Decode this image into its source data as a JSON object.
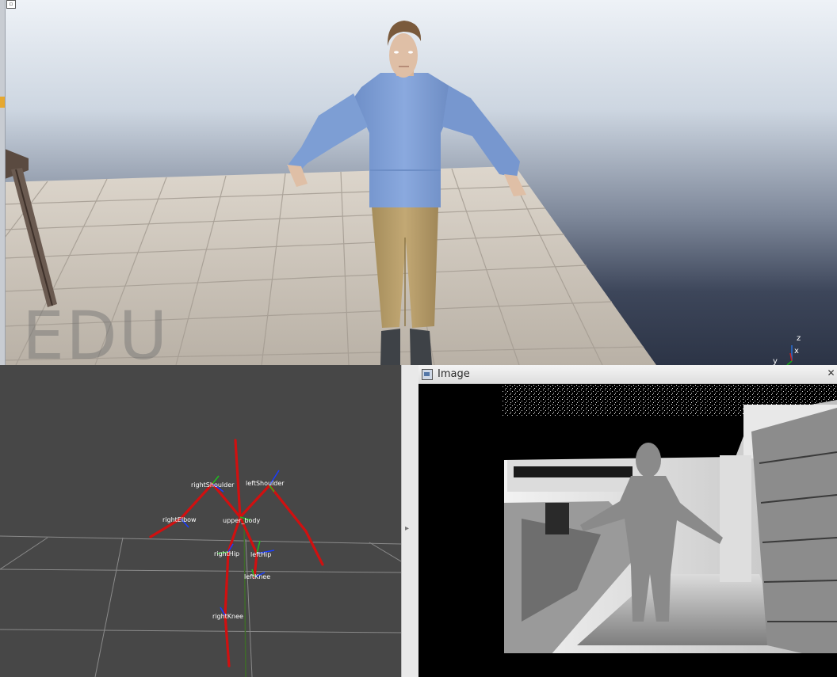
{
  "simulator": {
    "watermark_text": "EDU",
    "axis_labels": {
      "z": "z",
      "x": "x",
      "y": "y"
    },
    "colors": {
      "shirt": "#7f9fd6",
      "pants": "#b89f6a",
      "skin": "#dfbfa6",
      "hair": "#7a5a3c",
      "shoes": "#3e4247"
    }
  },
  "rviz": {
    "tf_frames": {
      "right_shoulder": "rightShoulder",
      "left_shoulder": "leftShoulder",
      "right_elbow": "rightElbow",
      "upper_body": "upper_body",
      "right_hip": "rightHip",
      "left_hip": "leftHip",
      "left_knee": "leftKnee",
      "right_knee": "rightKnee"
    },
    "skeleton_color": "#d01010"
  },
  "image_window": {
    "title": "Image",
    "close_glyph": "✕"
  }
}
